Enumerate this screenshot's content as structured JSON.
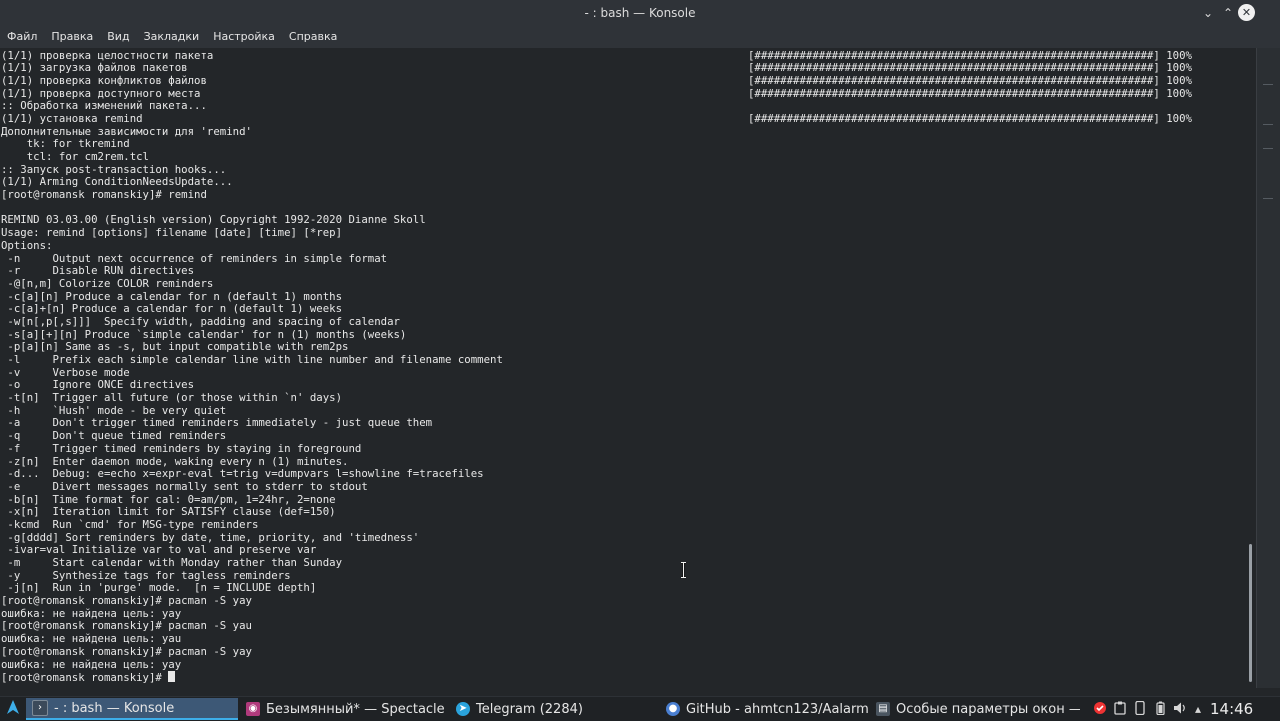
{
  "window": {
    "title": "- : bash — Konsole",
    "minimize": "⌄",
    "maximize": "⌃",
    "close": "✕"
  },
  "menu": [
    "Файл",
    "Правка",
    "Вид",
    "Закладки",
    "Настройка",
    "Справка"
  ],
  "terminal": {
    "lines": [
      "(1/1) проверка целостности пакета",
      "(1/1) загрузка файлов пакетов",
      "(1/1) проверка конфликтов файлов",
      "(1/1) проверка доступного места",
      ":: Обработка изменений пакета...",
      "(1/1) установка remind",
      "Дополнительные зависимости для 'remind'",
      "    tk: for tkremind",
      "    tcl: for cm2rem.tcl",
      ":: Запуск post-transaction hooks...",
      "(1/1) Arming ConditionNeedsUpdate...",
      "[root@romansk romanskiy]# remind",
      "",
      "REMIND 03.03.00 (English version) Copyright 1992-2020 Dianne Skoll",
      "Usage: remind [options] filename [date] [time] [*rep]",
      "Options:",
      " -n     Output next occurrence of reminders in simple format",
      " -r     Disable RUN directives",
      " -@[n,m] Colorize COLOR reminders",
      " -c[a][n] Produce a calendar for n (default 1) months",
      " -c[a]+[n] Produce a calendar for n (default 1) weeks",
      " -w[n[,p[,s]]]  Specify width, padding and spacing of calendar",
      " -s[a][+][n] Produce `simple calendar' for n (1) months (weeks)",
      " -p[a][n] Same as -s, but input compatible with rem2ps",
      " -l     Prefix each simple calendar line with line number and filename comment",
      " -v     Verbose mode",
      " -o     Ignore ONCE directives",
      " -t[n]  Trigger all future (or those within `n' days)",
      " -h     `Hush' mode - be very quiet",
      " -a     Don't trigger timed reminders immediately - just queue them",
      " -q     Don't queue timed reminders",
      " -f     Trigger timed reminders by staying in foreground",
      " -z[n]  Enter daemon mode, waking every n (1) minutes.",
      " -d...  Debug: e=echo x=expr-eval t=trig v=dumpvars l=showline f=tracefiles",
      " -e     Divert messages normally sent to stderr to stdout",
      " -b[n]  Time format for cal: 0=am/pm, 1=24hr, 2=none",
      " -x[n]  Iteration limit for SATISFY clause (def=150)",
      " -kcmd  Run `cmd' for MSG-type reminders",
      " -g[dddd] Sort reminders by date, time, priority, and 'timedness'",
      " -ivar=val Initialize var to val and preserve var",
      " -m     Start calendar with Monday rather than Sunday",
      " -y     Synthesize tags for tagless reminders",
      " -j[n]  Run in 'purge' mode.  [n = INCLUDE depth]",
      "[root@romansk romanskiy]# pacman -S yay",
      "ошибка: не найдена цель: yay",
      "[root@romansk romanskiy]# pacman -S yau",
      "ошибка: не найдена цель: yau",
      "[root@romansk romanskiy]# pacman -S yay",
      "ошибка: не найдена цель: yay",
      "[root@romansk romanskiy]# "
    ],
    "progress_lines": [
      0,
      1,
      2,
      3,
      5
    ],
    "progress_bar": "[##############################################################] 100%"
  },
  "taskbar": {
    "tasks": [
      {
        "label": "- : bash — Konsole",
        "icon": "terminal-icon",
        "color": "#3b4a5a",
        "active": true
      },
      {
        "label": "Безымянный* — Spectacle",
        "icon": "spectacle-icon",
        "color": "#b03a7c",
        "active": false
      },
      {
        "label": "Telegram (2284)",
        "icon": "telegram-icon",
        "color": "#2aa3dc",
        "active": false
      },
      {
        "label": "GitHub - ahmtcn123/Aalarm: ...",
        "icon": "chrome-icon",
        "color": "#4a7fd1",
        "active": false
      },
      {
        "label": "Особые параметры окон —...",
        "icon": "settings-window-icon",
        "color": "#4a5560",
        "active": false
      }
    ],
    "clock": "14:46"
  }
}
